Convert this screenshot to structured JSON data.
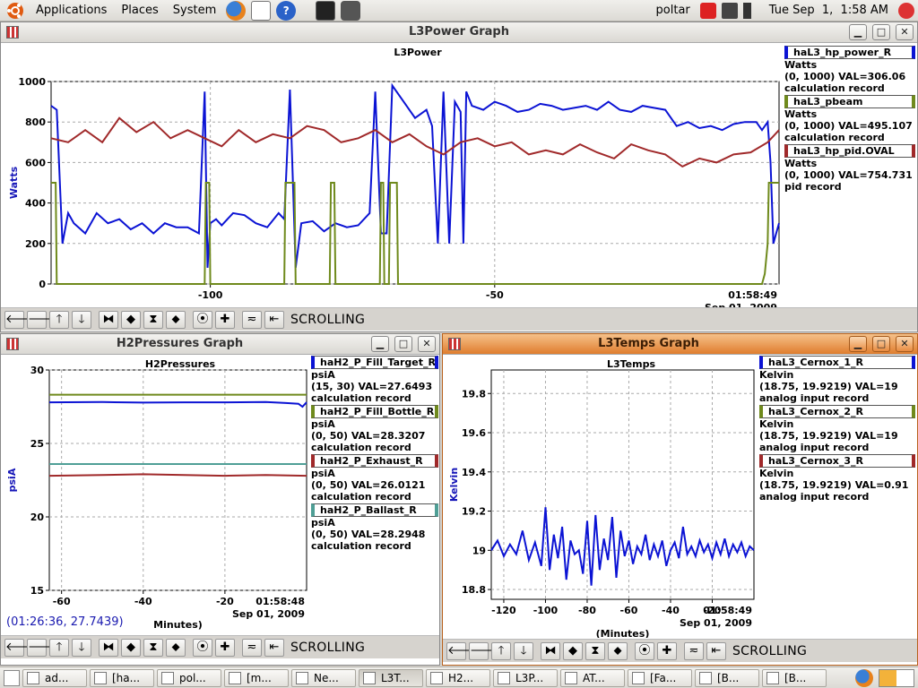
{
  "top_panel": {
    "menus": [
      "Applications",
      "Places",
      "System"
    ],
    "user": "poltar",
    "clock": "Tue Sep  1,  1:58 AM"
  },
  "taskbar": [
    {
      "label": "ad...",
      "active": false
    },
    {
      "label": "[ha...",
      "active": false
    },
    {
      "label": "pol...",
      "active": false
    },
    {
      "label": "[m...",
      "active": false
    },
    {
      "label": "Ne...",
      "active": false
    },
    {
      "label": "L3T...",
      "active": true
    },
    {
      "label": "H2...",
      "active": false
    },
    {
      "label": "L3P...",
      "active": false
    },
    {
      "label": "AT...",
      "active": false
    },
    {
      "label": "[Fa...",
      "active": false
    },
    {
      "label": "[B...",
      "active": false
    },
    {
      "label": "[B...",
      "active": false
    }
  ],
  "colors": {
    "blue": "#0b13d4",
    "red": "#a0292a",
    "green": "#6f8a1c",
    "teal": "#4f9f96"
  },
  "windows": {
    "l3power": {
      "window_title": "L3Power Graph",
      "graph_title": "L3Power",
      "scroll_label": "SCROLLING",
      "timestamp": "01:58:49",
      "date": "Sep 01, 2009",
      "chart_data": {
        "type": "line",
        "title": "L3Power",
        "xlabel": "(Minutes)",
        "ylabel": "Watts",
        "xlim": [
          -128,
          0
        ],
        "ylim": [
          0,
          1000
        ],
        "yticks": [
          "0",
          "200",
          "400",
          "600",
          "800",
          "1000"
        ],
        "xticks": [
          {
            "v": -100,
            "t": "-100"
          },
          {
            "v": -50,
            "t": "-50"
          }
        ],
        "series": [
          {
            "name": "haL3_hp_power_R",
            "color": "#0b13d4",
            "x": [
              -128,
              -127,
              -126,
              -125,
              -124,
              -122,
              -120,
              -118,
              -116,
              -114,
              -112,
              -110,
              -108,
              -106,
              -104,
              -102,
              -101,
              -100.5,
              -100,
              -99,
              -98,
              -96,
              -94,
              -92,
              -90,
              -88,
              -87,
              -86,
              -85,
              -84,
              -82,
              -80,
              -78,
              -76,
              -74,
              -72,
              -71,
              -70,
              -69,
              -68,
              -66,
              -64,
              -62,
              -61,
              -60,
              -59,
              -58,
              -57,
              -56,
              -55.5,
              -55,
              -54,
              -52,
              -50,
              -48,
              -46,
              -44,
              -42,
              -40,
              -38,
              -36,
              -34,
              -32,
              -30,
              -28,
              -26,
              -24,
              -22,
              -20,
              -18,
              -16,
              -14,
              -12,
              -10,
              -8,
              -6,
              -4,
              -3,
              -2,
              -1.5,
              -1,
              -0.5,
              0
            ],
            "y": [
              880,
              860,
              200,
              350,
              300,
              250,
              350,
              300,
              320,
              270,
              300,
              250,
              300,
              280,
              280,
              250,
              950,
              80,
              300,
              320,
              290,
              350,
              340,
              300,
              280,
              350,
              320,
              960,
              80,
              300,
              310,
              260,
              300,
              280,
              290,
              350,
              950,
              250,
              250,
              980,
              900,
              820,
              860,
              780,
              200,
              950,
              200,
              900,
              850,
              200,
              950,
              880,
              860,
              900,
              880,
              850,
              860,
              890,
              880,
              860,
              870,
              880,
              860,
              900,
              860,
              850,
              880,
              870,
              860,
              780,
              800,
              770,
              780,
              760,
              790,
              800,
              800,
              760,
              800,
              600,
              200,
              250,
              300
            ]
          },
          {
            "name": "haL3_pbeam",
            "color": "#6f8a1c",
            "x": [
              -128,
              -127.2,
              -127,
              -101,
              -100.8,
              -100.2,
              -100,
              -87,
              -86.8,
              -85.2,
              -85,
              -79,
              -78.8,
              -78.2,
              -78,
              -70.2,
              -70,
              -69.6,
              -69.4,
              -68.6,
              -68.4,
              -67.2,
              -67,
              -10,
              -3,
              -2.5,
              -2,
              -1.8,
              -1.5,
              0
            ],
            "y": [
              500,
              500,
              0,
              0,
              500,
              500,
              0,
              0,
              500,
              500,
              0,
              0,
              500,
              500,
              0,
              0,
              500,
              500,
              0,
              0,
              500,
              500,
              0,
              0,
              0,
              50,
              200,
              500,
              500,
              500
            ]
          },
          {
            "name": "haL3_hp_pid.OVAL",
            "color": "#a0292a",
            "x": [
              -128,
              -125,
              -122,
              -119,
              -116,
              -113,
              -110,
              -107,
              -104,
              -101,
              -98,
              -95,
              -92,
              -89,
              -86,
              -83,
              -80,
              -77,
              -74,
              -71,
              -68,
              -65,
              -62,
              -59,
              -56,
              -53,
              -50,
              -47,
              -44,
              -41,
              -38,
              -35,
              -32,
              -29,
              -26,
              -23,
              -20,
              -17,
              -14,
              -11,
              -8,
              -5,
              -2,
              0
            ],
            "y": [
              720,
              700,
              760,
              700,
              820,
              750,
              800,
              720,
              760,
              720,
              680,
              760,
              700,
              740,
              720,
              780,
              760,
              700,
              720,
              760,
              700,
              740,
              680,
              640,
              700,
              720,
              680,
              700,
              640,
              660,
              640,
              690,
              650,
              620,
              690,
              660,
              640,
              580,
              620,
              600,
              640,
              650,
              700,
              760
            ]
          }
        ]
      },
      "legend": [
        {
          "name": "haL3_hp_power_R",
          "units": "Watts",
          "value": "(0, 1000) VAL=306.06",
          "type": "calculation record",
          "color": "#0b13d4"
        },
        {
          "name": "haL3_pbeam",
          "units": "Watts",
          "value": "(0, 1000) VAL=495.107",
          "type": "calculation record",
          "color": "#6f8a1c"
        },
        {
          "name": "haL3_hp_pid.OVAL",
          "units": "Watts",
          "value": "(0, 1000) VAL=754.731",
          "type": "pid record",
          "color": "#a0292a"
        }
      ]
    },
    "h2pressures": {
      "window_title": "H2Pressures Graph",
      "graph_title": "H2Pressures",
      "scroll_label": "SCROLLING",
      "timestamp": "01:58:48",
      "date": "Sep 01, 2009",
      "cursor_readout": "(01:26:36, 27.7439)",
      "chart_data": {
        "type": "line",
        "title": "H2Pressures",
        "xlabel": "Minutes)",
        "ylabel": "psiA",
        "xlim": [
          -63,
          0
        ],
        "ylim": [
          15,
          30
        ],
        "yticks": [
          {
            "v": 15,
            "t": "15"
          },
          {
            "v": 20,
            "t": "20"
          },
          {
            "v": 25,
            "t": "25"
          },
          {
            "v": 30,
            "t": "30"
          }
        ],
        "xticks": [
          {
            "v": -60,
            "t": "-60"
          },
          {
            "v": -40,
            "t": "-40"
          },
          {
            "v": -20,
            "t": "-20"
          }
        ],
        "series": [
          {
            "name": "haH2_P_Fill_Target_R",
            "color": "#0b13d4",
            "x": [
              -63,
              -50,
              -40,
              -30,
              -20,
              -10,
              -5,
              -2,
              -1,
              0
            ],
            "y": [
              27.8,
              27.82,
              27.78,
              27.8,
              27.8,
              27.82,
              27.75,
              27.7,
              27.5,
              27.8
            ]
          },
          {
            "name": "haH2_P_Fill_Bottle_R",
            "color": "#6f8a1c",
            "x": [
              -63,
              0
            ],
            "y": [
              28.32,
              28.32
            ]
          },
          {
            "name": "haH2_P_Exhaust_R",
            "color": "#a0292a",
            "x": [
              -63,
              -50,
              -40,
              -30,
              -20,
              -10,
              0
            ],
            "y": [
              22.8,
              22.85,
              22.9,
              22.85,
              22.8,
              22.85,
              22.8
            ]
          },
          {
            "name": "haH2_P_Ballast_R",
            "color": "#4f9f96",
            "x": [
              -63,
              0
            ],
            "y": [
              23.6,
              23.6
            ]
          }
        ]
      },
      "legend": [
        {
          "name": "haH2_P_Fill_Target_R",
          "units": "psiA",
          "value": "(15, 30) VAL=27.6493",
          "type": "calculation record",
          "color": "#0b13d4"
        },
        {
          "name": "haH2_P_Fill_Bottle_R",
          "units": "psiA",
          "value": "(0, 50) VAL=28.3207",
          "type": "calculation record",
          "color": "#6f8a1c"
        },
        {
          "name": "haH2_P_Exhaust_R",
          "units": "psiA",
          "value": "(0, 50) VAL=26.0121",
          "type": "calculation record",
          "color": "#a0292a"
        },
        {
          "name": "haH2_P_Ballast_R",
          "units": "psiA",
          "value": "(0, 50) VAL=28.2948",
          "type": "calculation record",
          "color": "#4f9f96"
        }
      ]
    },
    "l3temps": {
      "window_title": "L3Temps Graph",
      "graph_title": "L3Temps",
      "scroll_label": "SCROLLING",
      "timestamp": "01:58:49",
      "date": "Sep 01, 2009",
      "chart_data": {
        "type": "line",
        "title": "L3Temps",
        "xlabel": "(Minutes)",
        "ylabel": "Kelvin",
        "xlim": [
          -126,
          0
        ],
        "ylim": [
          18.75,
          19.92
        ],
        "yticks": [
          {
            "v": 18.8,
            "t": "18.8"
          },
          {
            "v": 19,
            "t": "19"
          },
          {
            "v": 19.2,
            "t": "19.2"
          },
          {
            "v": 19.4,
            "t": "19.4"
          },
          {
            "v": 19.6,
            "t": "19.6"
          },
          {
            "v": 19.8,
            "t": "19.8"
          }
        ],
        "xticks": [
          {
            "v": -120,
            "t": "-120"
          },
          {
            "v": -100,
            "t": "-100"
          },
          {
            "v": -80,
            "t": "-80"
          },
          {
            "v": -60,
            "t": "-60"
          },
          {
            "v": -40,
            "t": "-40"
          },
          {
            "v": -20,
            "t": "-20"
          }
        ],
        "series": [
          {
            "name": "haL3_Cernox_1_R",
            "color": "#0b13d4",
            "x": [
              -126,
              -123,
              -120,
              -117,
              -114,
              -111,
              -108,
              -105,
              -102,
              -100,
              -98,
              -96,
              -94,
              -92,
              -90,
              -88,
              -86,
              -84,
              -82,
              -80,
              -78,
              -76,
              -74,
              -72,
              -70,
              -68,
              -66,
              -64,
              -62,
              -60,
              -58,
              -56,
              -54,
              -52,
              -50,
              -48,
              -46,
              -44,
              -42,
              -40,
              -38,
              -36,
              -34,
              -32,
              -30,
              -28,
              -26,
              -24,
              -22,
              -20,
              -18,
              -16,
              -14,
              -12,
              -10,
              -8,
              -6,
              -4,
              -2,
              0
            ],
            "y": [
              19.0,
              19.05,
              18.97,
              19.03,
              18.98,
              19.1,
              18.95,
              19.04,
              18.92,
              19.22,
              18.9,
              19.08,
              18.96,
              19.12,
              18.85,
              19.05,
              18.98,
              19.0,
              18.88,
              19.15,
              18.82,
              19.18,
              18.9,
              19.06,
              18.95,
              19.17,
              18.86,
              19.1,
              18.97,
              19.05,
              18.93,
              19.02,
              18.98,
              19.08,
              18.95,
              19.03,
              18.97,
              19.05,
              18.92,
              19.0,
              19.04,
              18.96,
              19.12,
              18.98,
              19.02,
              18.97,
              19.05,
              18.99,
              19.03,
              18.96,
              19.04,
              18.98,
              19.06,
              18.97,
              19.03,
              18.99,
              19.04,
              18.97,
              19.02,
              19.0
            ]
          }
        ]
      },
      "legend": [
        {
          "name": "haL3_Cernox_1_R",
          "units": "Kelvin",
          "value": "(18.75, 19.9219) VAL=19",
          "type": "analog input record",
          "color": "#0b13d4"
        },
        {
          "name": "haL3_Cernox_2_R",
          "units": "Kelvin",
          "value": "(18.75, 19.9219) VAL=19",
          "type": "analog input record",
          "color": "#6f8a1c"
        },
        {
          "name": "haL3_Cernox_3_R",
          "units": "Kelvin",
          "value": "(18.75, 19.9219) VAL=0.91",
          "type": "analog input record",
          "color": "#a0292a"
        }
      ]
    }
  }
}
